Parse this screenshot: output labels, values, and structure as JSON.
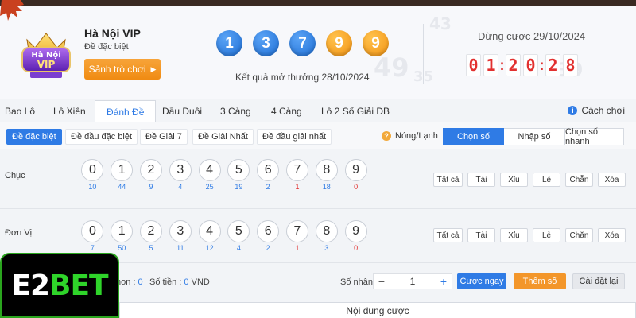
{
  "header": {
    "game_title": "Hà Nội VIP",
    "game_subtitle": "Đề đặc biệt",
    "lobby_button": "Sảnh trò chơi",
    "logo_text_top": "Hà Nội",
    "logo_text_bottom": "VIP",
    "result_balls": [
      {
        "value": "1",
        "color": "blue"
      },
      {
        "value": "3",
        "color": "blue"
      },
      {
        "value": "7",
        "color": "blue"
      },
      {
        "value": "9",
        "color": "orange"
      },
      {
        "value": "9",
        "color": "orange"
      }
    ],
    "result_label": "Kết quả mở thưởng 28/10/2024",
    "stop_label": "Dừng cược 29/10/2024",
    "timer": [
      "0",
      "1",
      "2",
      "0",
      "2",
      "8"
    ]
  },
  "tabs": {
    "items": [
      "Bao Lô",
      "Lô Xiên",
      "Đánh Đề",
      "Đầu Đuôi",
      "3 Càng",
      "4 Càng",
      "Lô 2 Số Giải ĐB"
    ],
    "active": "Đánh Đề",
    "help_label": "Cách chơi"
  },
  "subtabs": {
    "chips": [
      "Đề đặc biệt",
      "Đề đầu đặc biệt",
      "Đề Giải 7",
      "Đề Giải Nhất",
      "Đề đầu giải nhất"
    ],
    "hot_cold_label": "Nóng/Lạnh",
    "modes": [
      "Chọn số",
      "Nhập số",
      "Chọn số nhanh"
    ]
  },
  "rows": [
    {
      "label": "Chục",
      "numbers": [
        "0",
        "1",
        "2",
        "3",
        "4",
        "5",
        "6",
        "7",
        "8",
        "9"
      ],
      "counts": [
        "10",
        "44",
        "9",
        "4",
        "25",
        "19",
        "2",
        "1",
        "18",
        "0"
      ],
      "count_colors": [
        "blue",
        "blue",
        "blue",
        "blue",
        "blue",
        "blue",
        "blue",
        "red",
        "blue",
        "red"
      ]
    },
    {
      "label": "Đơn Vị",
      "numbers": [
        "0",
        "1",
        "2",
        "3",
        "4",
        "5",
        "6",
        "7",
        "8",
        "9"
      ],
      "counts": [
        "7",
        "50",
        "5",
        "11",
        "12",
        "4",
        "2",
        "1",
        "3",
        "0"
      ],
      "count_colors": [
        "blue",
        "blue",
        "blue",
        "blue",
        "blue",
        "blue",
        "blue",
        "red",
        "blue",
        "red"
      ]
    }
  ],
  "filters": [
    "Tất cả",
    "Tài",
    "Xỉu",
    "Lẻ",
    "Chẵn",
    "Xóa"
  ],
  "bottom": {
    "selected_label": "hon :",
    "selected_value": "0",
    "amount_label": "Số tiền :",
    "amount_value": "0",
    "amount_unit": "VND",
    "multiplier_label": "Số nhân :",
    "multiplier_value": "1",
    "bet_now": "Cược ngay",
    "add_number": "Thêm số",
    "reset": "Cài đặt lại"
  },
  "content_label": "Nội dung cược",
  "brand": {
    "part1": "E2",
    "part2": "BET"
  },
  "colors": {
    "accent_blue": "#2f7be5",
    "orange": "#f08b12",
    "timer_red": "#e2302f",
    "brand_green": "#2fd42a"
  }
}
